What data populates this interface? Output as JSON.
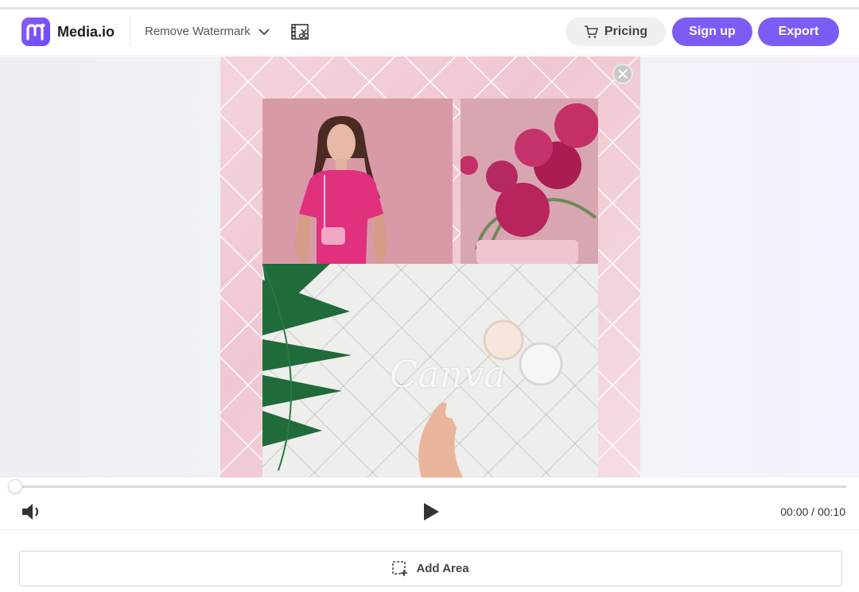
{
  "app": {
    "brand": "Media.io"
  },
  "header": {
    "tool_label": "Remove Watermark",
    "pricing_label": "Pricing",
    "signup_label": "Sign up",
    "export_label": "Export"
  },
  "preview": {
    "watermark_text": "Canva"
  },
  "player": {
    "time": "00:00 / 00:10",
    "progress": 0
  },
  "footer": {
    "add_area_label": "Add Area"
  },
  "colors": {
    "accent": "#7c5cf5",
    "pricing_bg": "#f0f0f4"
  }
}
